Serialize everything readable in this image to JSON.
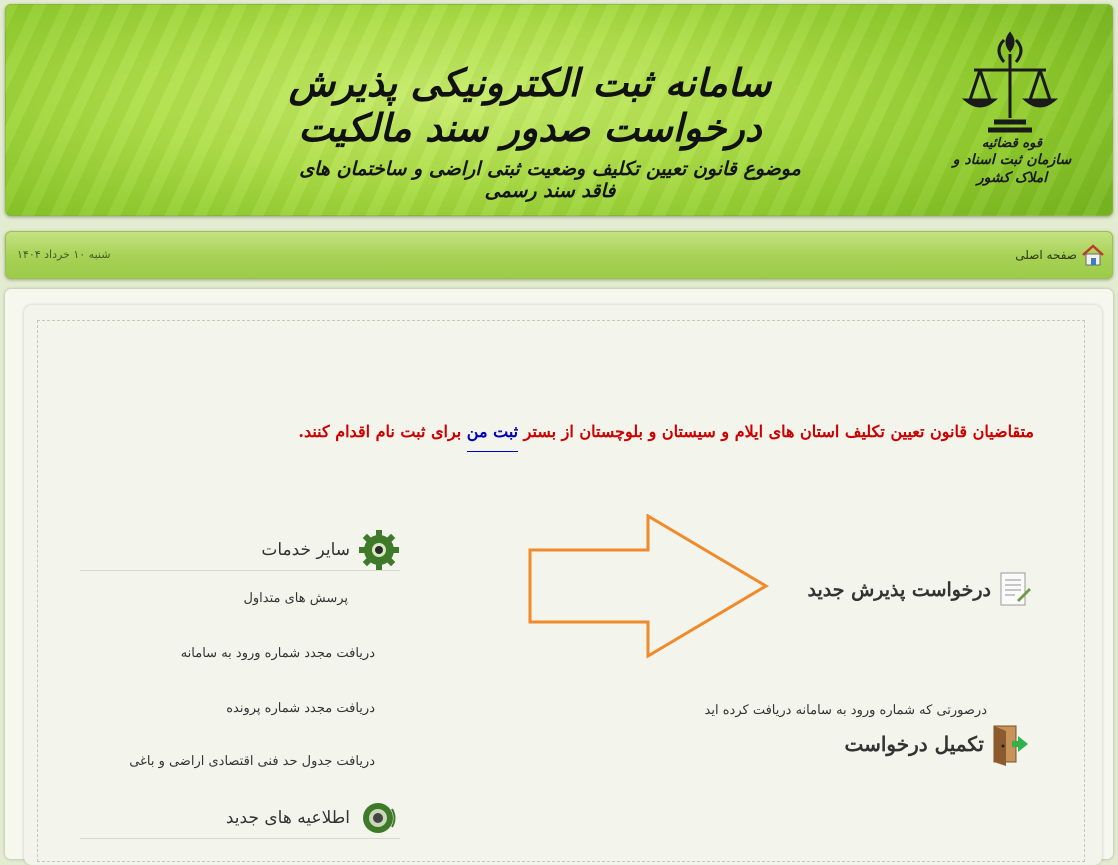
{
  "header": {
    "site_title": "سامانه ثبت الکترونیکی پذیرش درخواست صدور سند مالکیت",
    "site_subtitle": "موضوع قانون تعیین تکلیف وضعیت ثبتی اراضی و ساختمان های فاقد سند رسمی",
    "org_line1": "قوه قضائیه",
    "org_line2": "سازمان ثبت اسناد و املاک کشور"
  },
  "nav": {
    "home_label": "صفحه اصلی",
    "date": "شنبه ۱۰ خرداد ۱۴۰۴"
  },
  "notice": {
    "before": "متقاضیان قانون تعیین تکلیف استان های ایلام و سیستان و بلوچستان از بستر ",
    "link": "ثبت من",
    "after": " برای ثبت نام اقدام کنند."
  },
  "services": {
    "title": "سایر خدمات",
    "items": [
      {
        "label": "پرسش های متداول"
      },
      {
        "label": "دریافت مجدد شماره ورود به سامانه"
      },
      {
        "label": "دریافت مجدد شماره پرونده"
      },
      {
        "label": "دریافت جدول حد فنی اقتصادی اراضی و باغی"
      }
    ]
  },
  "news": {
    "title": "اطلاعیه های جدید"
  },
  "actions": {
    "new_request": "درخواست پذیرش جدید",
    "complete_hint": "درصورتی که شماره ورود به سامانه دریافت کرده اید",
    "complete_request": "تکمیل درخواست"
  },
  "colors": {
    "banner_green": "#a8d84a",
    "notice_red": "#cc0000",
    "link_blue": "#0000bb",
    "arrow_orange": "#f08a2a"
  },
  "icons": [
    "judiciary-emblem",
    "home-icon",
    "gear-icon",
    "speaker-icon",
    "document-icon",
    "exit-door-icon"
  ]
}
